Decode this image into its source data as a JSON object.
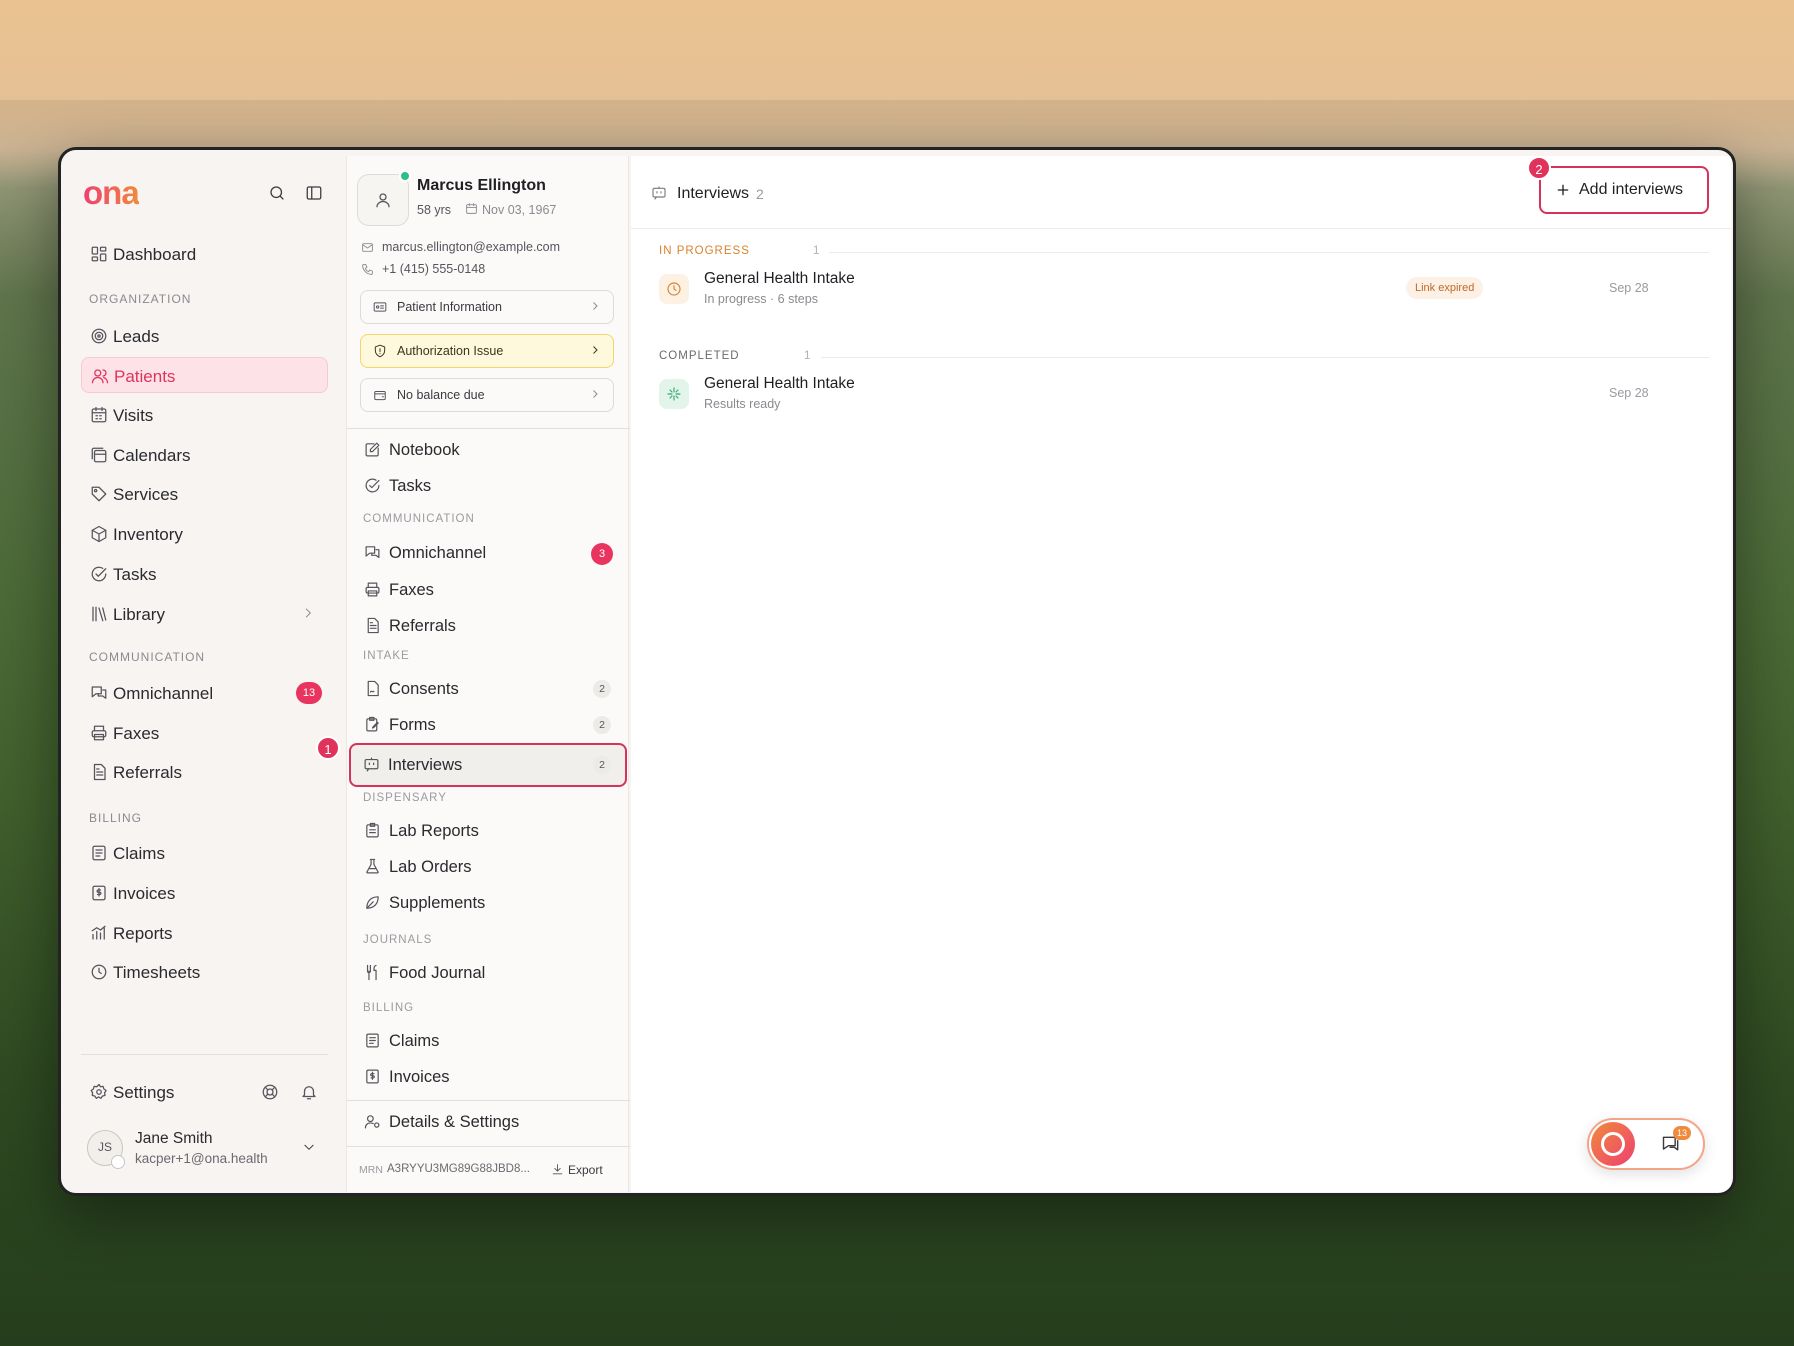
{
  "brand": {
    "logo": "ona"
  },
  "sidebar": {
    "dashboard": "Dashboard",
    "sections": {
      "organization": "ORGANIZATION",
      "communication": "COMMUNICATION",
      "billing": "BILLING"
    },
    "items": {
      "leads": "Leads",
      "patients": "Patients",
      "visits": "Visits",
      "calendars": "Calendars",
      "services": "Services",
      "inventory": "Inventory",
      "tasks": "Tasks",
      "library": "Library",
      "omnichannel": "Omnichannel",
      "omnichannel_count": "13",
      "faxes": "Faxes",
      "referrals": "Referrals",
      "claims": "Claims",
      "invoices": "Invoices",
      "reports": "Reports",
      "timesheets": "Timesheets"
    },
    "settings": "Settings",
    "user": {
      "initials": "JS",
      "name": "Jane Smith",
      "email": "kacper+1@ona.health"
    }
  },
  "callouts": {
    "one": "1",
    "two": "2"
  },
  "patient": {
    "name": "Marcus Ellington",
    "age": "58 yrs",
    "dob": "Nov 03, 1967",
    "email": "marcus.ellington@example.com",
    "phone": "+1 (415) 555-0148",
    "cards": {
      "info": "Patient Information",
      "auth": "Authorization Issue",
      "balance": "No balance due"
    },
    "nav": {
      "notebook": "Notebook",
      "tasks": "Tasks",
      "communication_section": "COMMUNICATION",
      "omnichannel": "Omnichannel",
      "omnichannel_count": "3",
      "faxes": "Faxes",
      "referrals": "Referrals",
      "intake_section": "INTAKE",
      "consents": "Consents",
      "consents_count": "2",
      "forms": "Forms",
      "forms_count": "2",
      "interviews": "Interviews",
      "interviews_count": "2",
      "dispensary_section": "DISPENSARY",
      "lab_reports": "Lab Reports",
      "lab_orders": "Lab Orders",
      "supplements": "Supplements",
      "journals_section": "JOURNALS",
      "food_journal": "Food Journal",
      "billing_section": "BILLING",
      "claims": "Claims",
      "invoices": "Invoices",
      "details": "Details & Settings"
    },
    "mrn_label": "MRN",
    "mrn": "A3RYYU3MG89G88JBD8...",
    "export": "Export"
  },
  "main": {
    "title": "Interviews",
    "count": "2",
    "add_button": "Add interviews",
    "groups": [
      {
        "label": "IN PROGRESS",
        "count": "1",
        "title": "General Health Intake",
        "sub": "In progress · 6 steps",
        "badge": "Link expired",
        "date": "Sep 28"
      },
      {
        "label": "COMPLETED",
        "count": "1",
        "title": "General Health Intake",
        "sub": "Results ready",
        "date": "Sep 28"
      }
    ],
    "chat_count": "13"
  },
  "colors": {
    "accent": "#e0335c",
    "in_progress": "#d9822b",
    "completed": "#2fa86b",
    "warning_bg": "#fef8dc"
  }
}
